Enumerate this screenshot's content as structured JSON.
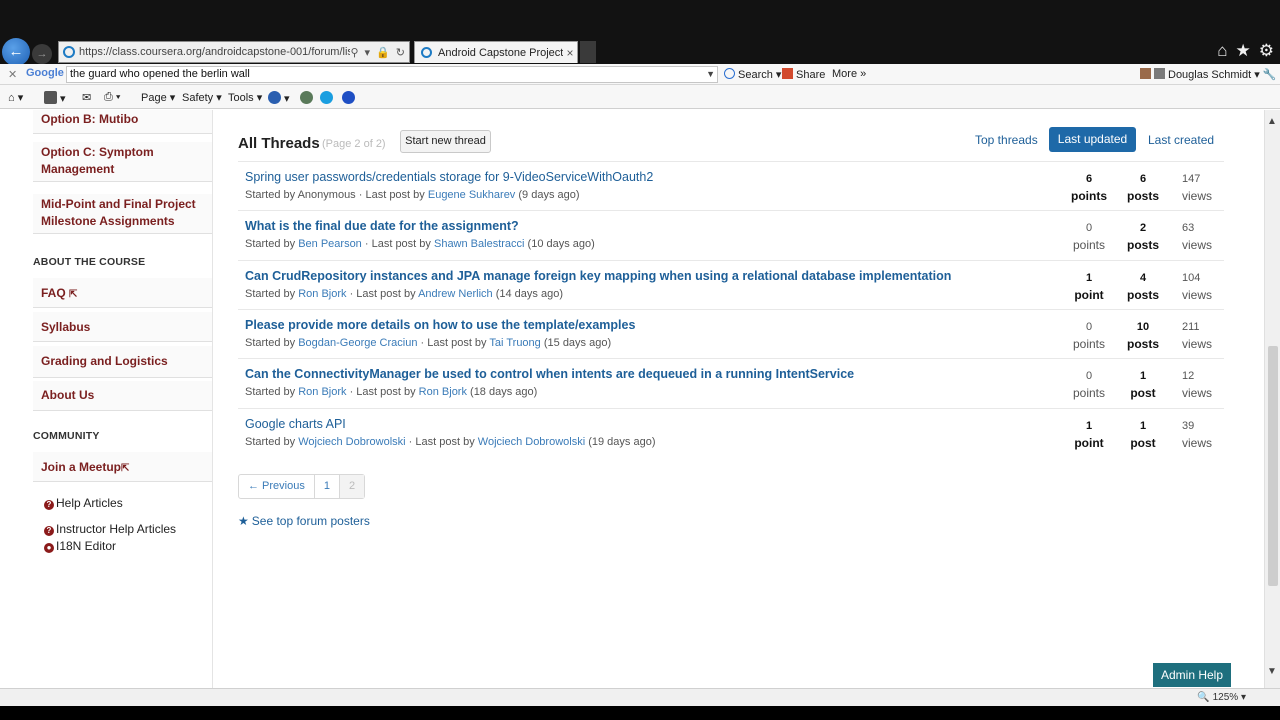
{
  "browser": {
    "address_url": "https://class.coursera.org/androidcapstone-001/forum/list?",
    "tab_title": "Android Capstone Project | ...",
    "tab_close": "×",
    "google_search_value": "the guard who opened the berlin wall",
    "google_logo": "Google",
    "search_label": "Search",
    "share_label": "Share",
    "more_label": "More",
    "user_label": "Douglas Schmidt",
    "cmd_page": "Page",
    "cmd_safety": "Safety",
    "cmd_tools": "Tools"
  },
  "sidebar": {
    "top_items": [
      {
        "label": "Option B: Mutibo"
      },
      {
        "label": "Option C: Symptom Management"
      },
      {
        "label": "Mid-Point and Final Project Milestone Assignments"
      }
    ],
    "about_heading": "ABOUT THE COURSE",
    "about_items": [
      {
        "label": "FAQ"
      },
      {
        "label": "Syllabus"
      },
      {
        "label": "Grading and Logistics"
      },
      {
        "label": "About Us"
      }
    ],
    "community_heading": "COMMUNITY",
    "community_items": [
      {
        "label": "Join a Meetup"
      }
    ],
    "links": [
      {
        "label": "Help Articles"
      },
      {
        "label": "Instructor Help Articles"
      },
      {
        "label": "I18N Editor"
      }
    ]
  },
  "forum": {
    "title": "All Threads",
    "page_note": "(Page 2 of 2)",
    "start_thread_label": "Start new thread",
    "sort_options": [
      "Top threads",
      "Last updated",
      "Last created"
    ],
    "threads": [
      {
        "title": "Spring user passwords/credentials storage for 9-VideoServiceWithOauth2",
        "bold": false,
        "started_label": "Started by",
        "starter": "Anonymous",
        "starter_link": false,
        "last_label": "· Last post by",
        "last_poster": "Eugene Sukharev",
        "ago": "(9 days ago)",
        "points": "6",
        "points_label": "points",
        "posts": "6",
        "posts_label": "posts",
        "views": "147",
        "views_label": "views",
        "points_bold": true,
        "posts_bold": true
      },
      {
        "title": "What is the final due date for the assignment?",
        "bold": true,
        "started_label": "Started by",
        "starter": "Ben Pearson",
        "starter_link": true,
        "last_label": "· Last post by",
        "last_poster": "Shawn Balestracci",
        "ago": "(10 days ago)",
        "points": "0",
        "points_label": "points",
        "posts": "2",
        "posts_label": "posts",
        "views": "63",
        "views_label": "views",
        "points_bold": false,
        "posts_bold": true
      },
      {
        "title": "Can CrudRepository instances and JPA manage foreign key mapping when using a relational database implementation",
        "bold": true,
        "started_label": "Started by",
        "starter": "Ron Bjork",
        "starter_link": true,
        "last_label": "· Last post by",
        "last_poster": "Andrew Nerlich",
        "ago": "(14 days ago)",
        "points": "1",
        "points_label": "point",
        "posts": "4",
        "posts_label": "posts",
        "views": "104",
        "views_label": "views",
        "points_bold": true,
        "posts_bold": true
      },
      {
        "title": "Please provide more details on how to use the template/examples",
        "bold": true,
        "started_label": "Started by",
        "starter": "Bogdan-George Craciun",
        "starter_link": true,
        "last_label": "· Last post by",
        "last_poster": "Tai Truong",
        "ago": "(15 days ago)",
        "points": "0",
        "points_label": "points",
        "posts": "10",
        "posts_label": "posts",
        "views": "211",
        "views_label": "views",
        "points_bold": false,
        "posts_bold": true
      },
      {
        "title": "Can the ConnectivityManager be used to control when intents are dequeued in a running IntentService",
        "bold": true,
        "started_label": "Started by",
        "starter": "Ron Bjork",
        "starter_link": true,
        "last_label": "· Last post by",
        "last_poster": "Ron Bjork",
        "ago": "(18 days ago)",
        "points": "0",
        "points_label": "points",
        "posts": "1",
        "posts_label": "post",
        "views": "12",
        "views_label": "views",
        "points_bold": false,
        "posts_bold": true
      },
      {
        "title": "Google charts API",
        "bold": false,
        "started_label": "Started by",
        "starter": "Wojciech Dobrowolski",
        "starter_link": true,
        "last_label": "· Last post by",
        "last_poster": "Wojciech Dobrowolski",
        "ago": "(19 days ago)",
        "points": "1",
        "points_label": "point",
        "posts": "1",
        "posts_label": "post",
        "views": "39",
        "views_label": "views",
        "points_bold": true,
        "posts_bold": true
      }
    ],
    "pager": {
      "prev": "← Previous",
      "page1": "1",
      "page2": "2"
    },
    "top_posters": "See top forum posters"
  },
  "admin_help": "Admin Help",
  "status": {
    "zoom": "125%"
  },
  "colors": {
    "link": "#1e5f98",
    "accent": "#1e69a8",
    "sidebar_text": "#7a1f1f",
    "admin": "#1e6f7e"
  }
}
